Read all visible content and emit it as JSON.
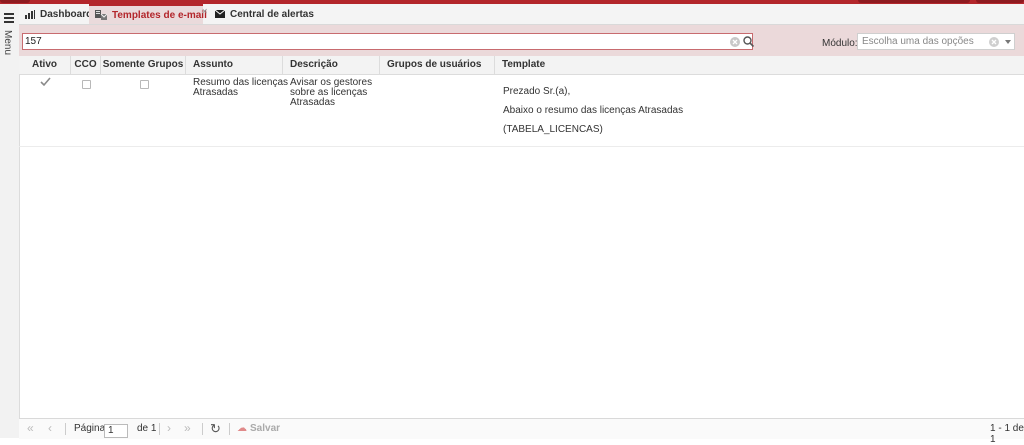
{
  "sidebar": {
    "menu_label": "Menu"
  },
  "tabs": [
    {
      "label": "Dashboard"
    },
    {
      "label": "Templates de e-mail",
      "active": true
    },
    {
      "label": "Central de alertas"
    }
  ],
  "filter": {
    "search_value": "157",
    "module_label": "Módulo:",
    "module_placeholder": "Escolha uma das opções"
  },
  "table": {
    "columns": [
      "Ativo",
      "CCO",
      "Somente Grupos",
      "Assunto",
      "Descrição",
      "Grupos de usuários",
      "Template"
    ],
    "rows": [
      {
        "ativo": true,
        "cco": false,
        "somente_grupos": false,
        "assunto": [
          "Resumo das licenças",
          "Atrasadas"
        ],
        "descricao": [
          "Avisar os gestores",
          "sobre as licenças",
          "Atrasadas"
        ],
        "grupos": "",
        "template": [
          "Prezado Sr.(a),",
          "Abaixo o resumo das licenças Atrasadas",
          "(TABELA_LICENCAS)"
        ]
      }
    ]
  },
  "pager": {
    "page_label": "Página",
    "page_value": "1",
    "of_label": "de 1",
    "save_label": "Salvar",
    "range_text": "1 - 1 de 1"
  },
  "colors": {
    "accent": "#b3262b",
    "filter_bg": "#ebd9da"
  }
}
